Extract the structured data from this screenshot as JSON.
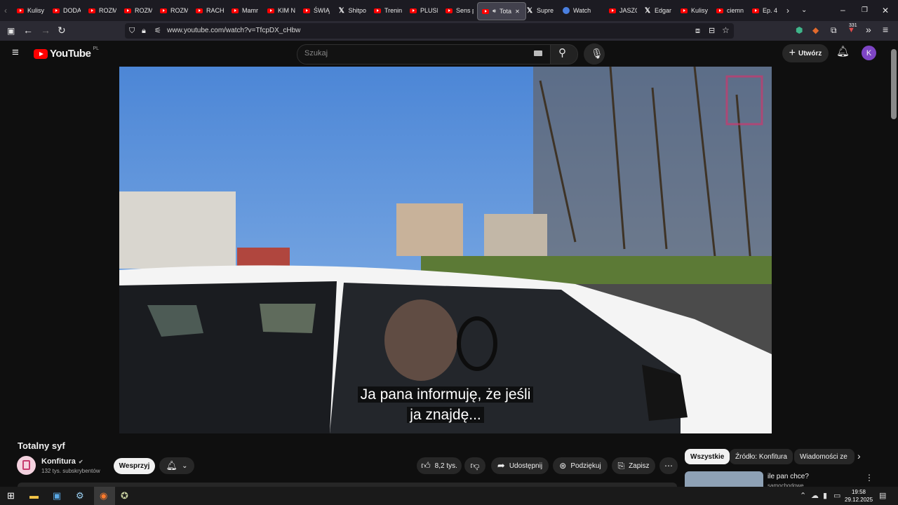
{
  "browser": {
    "tabs": [
      {
        "label": "Kulisy",
        "icon": "youtube-favicon"
      },
      {
        "label": "DODA",
        "icon": "youtube-favicon"
      },
      {
        "label": "ROZM",
        "icon": "youtube-favicon"
      },
      {
        "label": "ROZM",
        "icon": "youtube-favicon"
      },
      {
        "label": "ROZM",
        "icon": "youtube-favicon"
      },
      {
        "label": "RACH",
        "icon": "youtube-favicon"
      },
      {
        "label": "Mamr",
        "icon": "youtube-favicon"
      },
      {
        "label": "KIM N",
        "icon": "youtube-favicon"
      },
      {
        "label": "ŚWIĄ",
        "icon": "youtube-favicon"
      },
      {
        "label": "Shitpo",
        "icon": "x-favicon"
      },
      {
        "label": "Trenin",
        "icon": "youtube-favicon"
      },
      {
        "label": "PLUSI",
        "icon": "youtube-favicon"
      },
      {
        "label": "Sens p",
        "icon": "youtube-favicon"
      },
      {
        "label": "Tota",
        "icon": "youtube-favicon",
        "active": true
      },
      {
        "label": "Supre",
        "icon": "x-favicon"
      },
      {
        "label": "Watch",
        "icon": "watch-favicon"
      },
      {
        "label": "JASZC",
        "icon": "youtube-favicon"
      },
      {
        "label": "Edgar",
        "icon": "x-favicon"
      },
      {
        "label": "Kulisy",
        "icon": "youtube-favicon"
      },
      {
        "label": "ciemn",
        "icon": "youtube-favicon"
      },
      {
        "label": "Ep. 4",
        "icon": "youtube-favicon"
      }
    ],
    "url": "www.youtube.com/watch?v=TfcpDX_cHbw",
    "extension_badge": "331"
  },
  "youtube": {
    "logo_text": "YouTube",
    "country_code": "PL",
    "search_placeholder": "Szukaj",
    "create_label": "Utwórz",
    "avatar_letter": "K"
  },
  "video": {
    "caption_line1": "Ja pana informuję, że jeśli",
    "caption_line2": "ja znajdę..."
  },
  "details": {
    "title": "Totalny syf",
    "channel_name": "Konfitura",
    "subscribers": "132 tys. subskrybentów",
    "support_label": "Wesprzyj",
    "likes": "8,2 tys.",
    "share_label": "Udostępnij",
    "thanks_label": "Podziękuj",
    "save_label": "Zapisz"
  },
  "sidebar": {
    "chips": [
      "Wszystkie",
      "Źródło: Konfitura",
      "Wiadomości ze"
    ],
    "first_video_title": "ile pan chce?",
    "first_video_channel": "samochodowe"
  },
  "taskbar": {
    "time": "19:58",
    "date": "29.12.2025"
  }
}
